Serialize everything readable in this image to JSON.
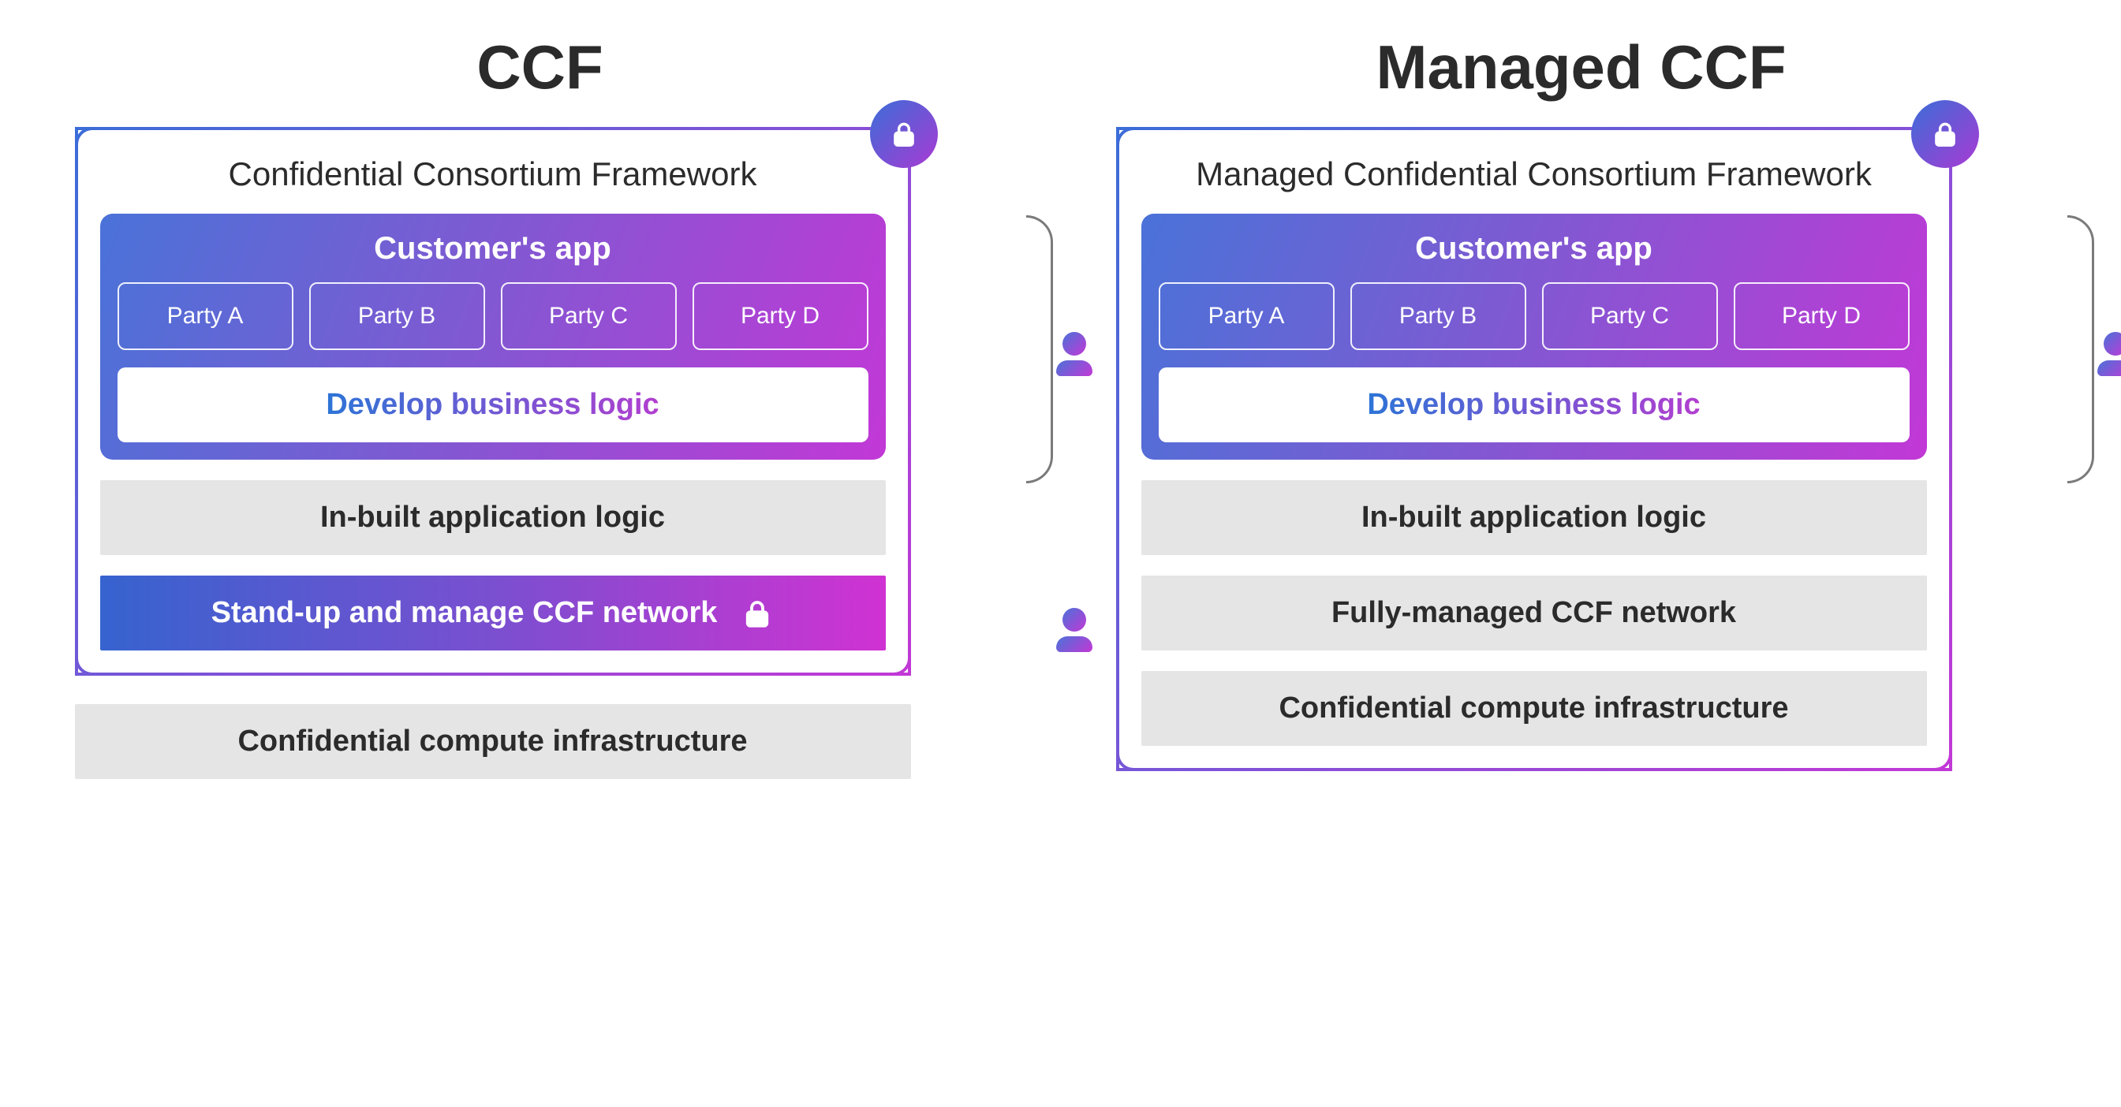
{
  "left": {
    "heading": "CCF",
    "framework_title": "Confidential Consortium Framework",
    "app_title": "Customer's app",
    "parties": [
      "Party A",
      "Party B",
      "Party C",
      "Party D"
    ],
    "develop_label": "Develop business logic",
    "inbuilt_label": "In-built application logic",
    "manage_label": "Stand-up and manage CCF network",
    "infra_label": "Confidential compute infrastructure"
  },
  "right": {
    "heading": "Managed CCF",
    "framework_title": "Managed Confidential Consortium Framework",
    "app_title": "Customer's app",
    "parties": [
      "Party A",
      "Party B",
      "Party C",
      "Party D"
    ],
    "develop_label": "Develop business logic",
    "inbuilt_label": "In-built application logic",
    "manage_label": "Fully-managed CCF network",
    "infra_label": "Confidential compute infrastructure"
  }
}
